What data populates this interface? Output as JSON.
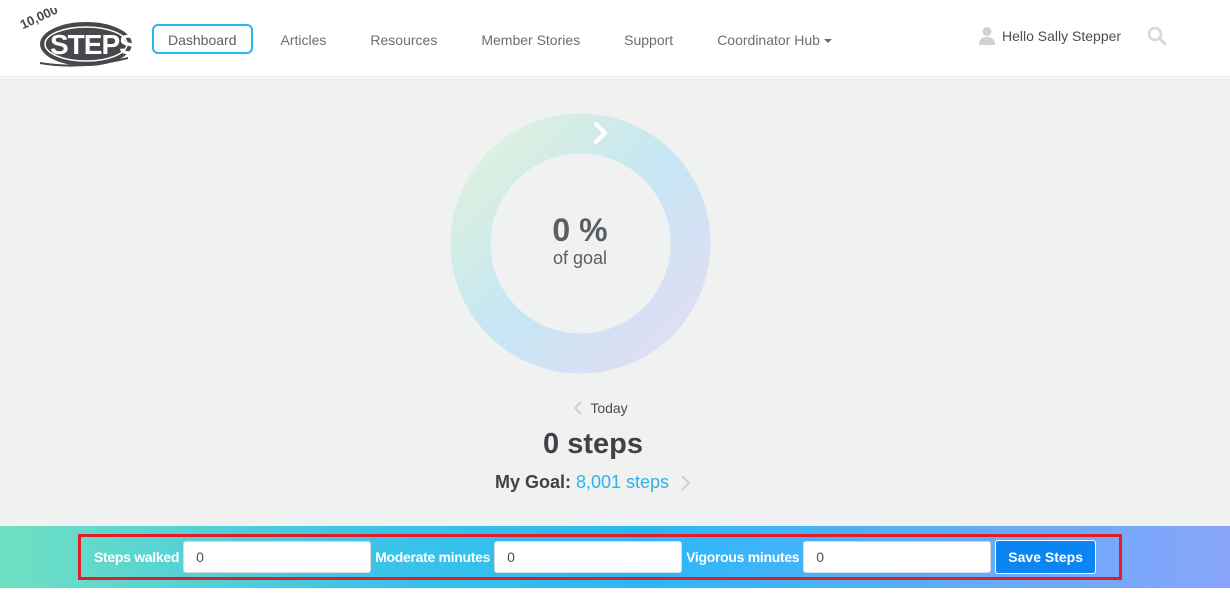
{
  "header": {
    "logo_alt": "10,000 Steps",
    "nav": [
      {
        "label": "Dashboard",
        "active": true
      },
      {
        "label": "Articles",
        "active": false
      },
      {
        "label": "Resources",
        "active": false
      },
      {
        "label": "Member Stories",
        "active": false
      },
      {
        "label": "Support",
        "active": false
      },
      {
        "label": "Coordinator Hub",
        "active": false,
        "dropdown": true
      }
    ],
    "user_greeting": "Hello Sally Stepper",
    "icons": {
      "user": "user-icon",
      "search": "search-icon"
    }
  },
  "progress": {
    "percent_text": "0 %",
    "percent_value": 0,
    "subtitle": "of goal"
  },
  "day": {
    "label": "Today",
    "steps_text": "0 steps",
    "goal_label": "My Goal:",
    "goal_value": "8,001 steps"
  },
  "log_form": {
    "steps_label": "Steps walked",
    "steps_value": "0",
    "moderate_label": "Moderate minutes",
    "moderate_value": "0",
    "vigorous_label": "Vigorous minutes",
    "vigorous_value": "0",
    "save_label": "Save Steps"
  },
  "colors": {
    "accent": "#2bb5ee",
    "link": "#2fb1ec",
    "save_button": "#0b85f2",
    "highlight_border": "#e11d2a"
  }
}
